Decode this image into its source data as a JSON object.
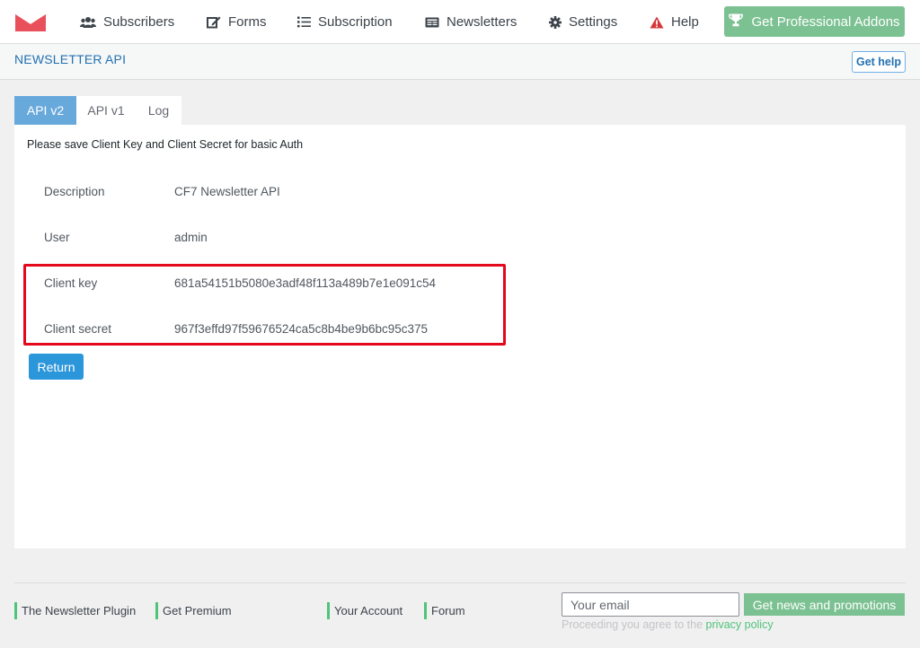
{
  "nav": {
    "logo_icon": "envelope-logo-icon",
    "items": [
      {
        "label": "Subscribers",
        "icon": "users-icon"
      },
      {
        "label": "Forms",
        "icon": "edit-icon"
      },
      {
        "label": "Subscription",
        "icon": "list-icon"
      },
      {
        "label": "Newsletters",
        "icon": "newspaper-icon"
      },
      {
        "label": "Settings",
        "icon": "gear-icon"
      },
      {
        "label": "Help",
        "icon": "warning-icon"
      }
    ],
    "pro_button": {
      "label": "Get Professional Addons",
      "icon": "trophy-icon"
    }
  },
  "header": {
    "title": "NEWSLETTER API",
    "help_label": "Get help"
  },
  "tabs": [
    {
      "label": "API v2",
      "active": true
    },
    {
      "label": "API v1",
      "active": false
    },
    {
      "label": "Log",
      "active": false
    }
  ],
  "panel": {
    "notice": "Please save Client Key and Client Secret for basic Auth",
    "fields": [
      {
        "label": "Description",
        "value": "CF7 Newsletter API"
      },
      {
        "label": "User",
        "value": "admin"
      },
      {
        "label": "Client key",
        "value": "681a54151b5080e3adf48f113a489b7e1e091c54"
      },
      {
        "label": "Client secret",
        "value": "967f3effd97f59676524ca5c8b4be9b6bc95c375"
      }
    ],
    "return_label": "Return"
  },
  "footer": {
    "links": [
      "The Newsletter Plugin",
      "Get Premium",
      "Your Account",
      "Forum"
    ],
    "email_placeholder": "Your email",
    "news_button": "Get news and promotions",
    "policy_prefix": "Proceeding you agree to the",
    "policy_link": "privacy policy"
  },
  "colors": {
    "accent_blue": "#2271b1",
    "active_tab": "#68a9dc",
    "green": "#7cc192",
    "highlight_red": "#e3081c"
  }
}
